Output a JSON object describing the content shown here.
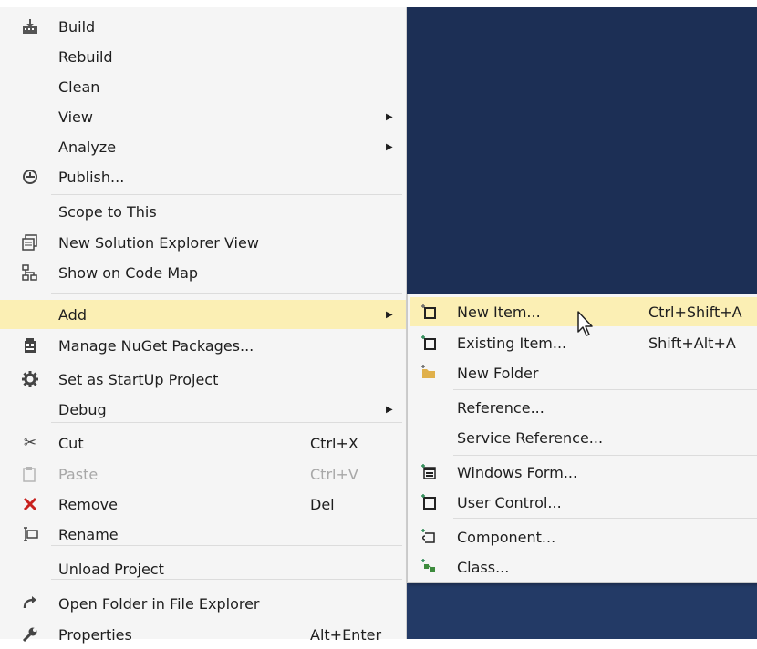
{
  "menu": {
    "items": [
      {
        "label": "Build",
        "icon": "build-icon",
        "glyph": "⛭",
        "color": "#444444",
        "shortcut": "",
        "submenu": false
      },
      {
        "label": "Rebuild",
        "icon": "",
        "glyph": "",
        "shortcut": "",
        "submenu": false
      },
      {
        "label": "Clean",
        "icon": "",
        "glyph": "",
        "shortcut": "",
        "submenu": false
      },
      {
        "label": "View",
        "icon": "",
        "glyph": "",
        "shortcut": "",
        "submenu": true
      },
      {
        "label": "Analyze",
        "icon": "",
        "glyph": "",
        "shortcut": "",
        "submenu": true
      },
      {
        "label": "Publish...",
        "icon": "publish-icon",
        "glyph": "⊜",
        "color": "#444444",
        "shortcut": "",
        "submenu": false
      },
      {
        "label": "Scope to This",
        "icon": "",
        "glyph": "",
        "shortcut": "",
        "submenu": false
      },
      {
        "label": "New Solution Explorer View",
        "icon": "new-solution-explorer-view-icon",
        "glyph": "▤",
        "color": "#444444",
        "shortcut": "",
        "submenu": false
      },
      {
        "label": "Show on Code Map",
        "icon": "code-map-icon",
        "glyph": "♗",
        "color": "#444444",
        "shortcut": "",
        "submenu": false
      },
      {
        "label": "Add",
        "icon": "",
        "glyph": "",
        "shortcut": "",
        "submenu": true,
        "highlight": true
      },
      {
        "label": "Manage NuGet Packages...",
        "icon": "nuget-icon",
        "glyph": "▦",
        "color": "#444444",
        "shortcut": "",
        "submenu": false
      },
      {
        "label": "Set as StartUp Project",
        "icon": "gear-icon",
        "glyph": "⚙",
        "color": "#444444",
        "shortcut": "",
        "submenu": false
      },
      {
        "label": "Debug",
        "icon": "",
        "glyph": "",
        "shortcut": "",
        "submenu": true
      },
      {
        "label": "Cut",
        "icon": "cut-icon",
        "glyph": "✂",
        "color": "#444444",
        "shortcut": "Ctrl+X",
        "submenu": false
      },
      {
        "label": "Paste",
        "icon": "paste-icon",
        "glyph": "▯",
        "color": "#a8a8a8",
        "shortcut": "Ctrl+V",
        "submenu": false,
        "disabled": true
      },
      {
        "label": "Remove",
        "icon": "remove-icon",
        "glyph": "✕",
        "color": "#c8201e",
        "shortcut": "Del",
        "submenu": false
      },
      {
        "label": "Rename",
        "icon": "rename-icon",
        "glyph": "⌶",
        "color": "#444444",
        "shortcut": "",
        "submenu": false
      },
      {
        "label": "Unload Project",
        "icon": "",
        "glyph": "",
        "shortcut": "",
        "submenu": false
      },
      {
        "label": "Open Folder in File Explorer",
        "icon": "open-folder-icon",
        "glyph": "↻",
        "color": "#444444",
        "shortcut": "",
        "submenu": false
      },
      {
        "label": "Properties",
        "icon": "wrench-icon",
        "glyph": "✎",
        "color": "#444444",
        "shortcut": "Alt+Enter",
        "submenu": false
      }
    ]
  },
  "submenu": {
    "items": [
      {
        "label": "New Item...",
        "icon": "new-item-icon",
        "glyph": "◻",
        "color": "#333333",
        "shortcut": "Ctrl+Shift+A",
        "highlight": true
      },
      {
        "label": "Existing Item...",
        "icon": "existing-item-icon",
        "glyph": "◻",
        "color": "#333333",
        "shortcut": "Shift+Alt+A"
      },
      {
        "label": "New Folder",
        "icon": "new-folder-icon",
        "glyph": "▬",
        "color": "#d8a838",
        "shortcut": ""
      },
      {
        "label": "Reference...",
        "icon": "",
        "glyph": "",
        "shortcut": ""
      },
      {
        "label": "Service Reference...",
        "icon": "",
        "glyph": "",
        "shortcut": ""
      },
      {
        "label": "Windows Form...",
        "icon": "windows-form-icon",
        "glyph": "▣",
        "color": "#333333",
        "shortcut": ""
      },
      {
        "label": "User Control...",
        "icon": "user-control-icon",
        "glyph": "◻",
        "color": "#333333",
        "shortcut": ""
      },
      {
        "label": "Component...",
        "icon": "component-icon",
        "glyph": "▭",
        "color": "#333333",
        "shortcut": ""
      },
      {
        "label": "Class...",
        "icon": "class-icon",
        "glyph": "⚘",
        "color": "#2e7d32",
        "shortcut": ""
      }
    ]
  }
}
